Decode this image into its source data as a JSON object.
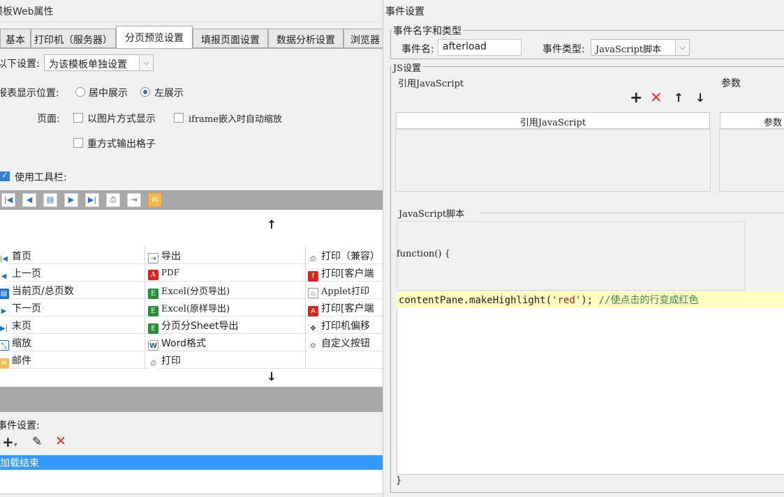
{
  "left_panel": {
    "title": "模板Web属性",
    "tabs": [
      "基本",
      "打印机（服务器）",
      "分页预览设置",
      "填报页面设置",
      "数据分析设置",
      "浏览器"
    ],
    "active_tab_index": 2,
    "settings_label": "以下设置:",
    "settings_combo_value": "为该模板单独设置",
    "report_position_label": "报表显示位置:",
    "position_options": [
      "居中展示",
      "左展示"
    ],
    "position_selected": "左展示",
    "page_label": "页面:",
    "page_options": [
      "以图片方式显示",
      "iframe嵌入时自动缩放",
      "重方式输出格子"
    ],
    "use_toolbar_label": "使用工具栏:",
    "use_toolbar_checked": true,
    "toolbar_icons": [
      "first-page-icon",
      "prev-page-icon",
      "page-count-icon",
      "next-page-icon",
      "last-page-icon",
      "print-icon",
      "export-icon",
      "mail-icon"
    ],
    "button_items": [
      [
        "首页",
        "导出",
        "打印（兼容）"
      ],
      [
        "上一页",
        "PDF",
        "打印[客户端"
      ],
      [
        "当前页/总页数",
        "Excel(分页导出)",
        "Applet打印"
      ],
      [
        "下一页",
        "Excel(原样导出)",
        "打印[客户端"
      ],
      [
        "末页",
        "分页分Sheet导出",
        "打印机偏移"
      ],
      [
        "缩放",
        "Word格式",
        "自定义按钮"
      ],
      [
        "邮件",
        "打印",
        ""
      ]
    ],
    "event_settings_label": "事件设置:",
    "event_items": [
      "加载结束"
    ],
    "colors": {
      "selection": "#3399ff",
      "toolbar_gray": "#a8a8a8"
    }
  },
  "right_panel": {
    "title": "事件设置",
    "name_type_group": "事件名字和类型",
    "event_name_label": "事件名:",
    "event_name_value": "afterload",
    "event_type_label": "事件类型:",
    "event_type_value": "JavaScript脚本",
    "js_group": "JS设置",
    "ref_js_label": "引用JavaScript",
    "params_label": "参数",
    "ref_table_header": "引用JavaScript",
    "params_table_header": "参数",
    "script_label": "JavaScript脚本",
    "function_header": "function() {",
    "code_line": {
      "code": "contentPane.makeHighlight(",
      "string": "'red'",
      "rest": "); ",
      "comment": "//使点击的行变成红色"
    },
    "closing_brace": "}",
    "colors": {
      "highlight": "#ffffc0",
      "delete": "#e03030",
      "string": "#b22222",
      "comment": "#2e8b57"
    }
  }
}
